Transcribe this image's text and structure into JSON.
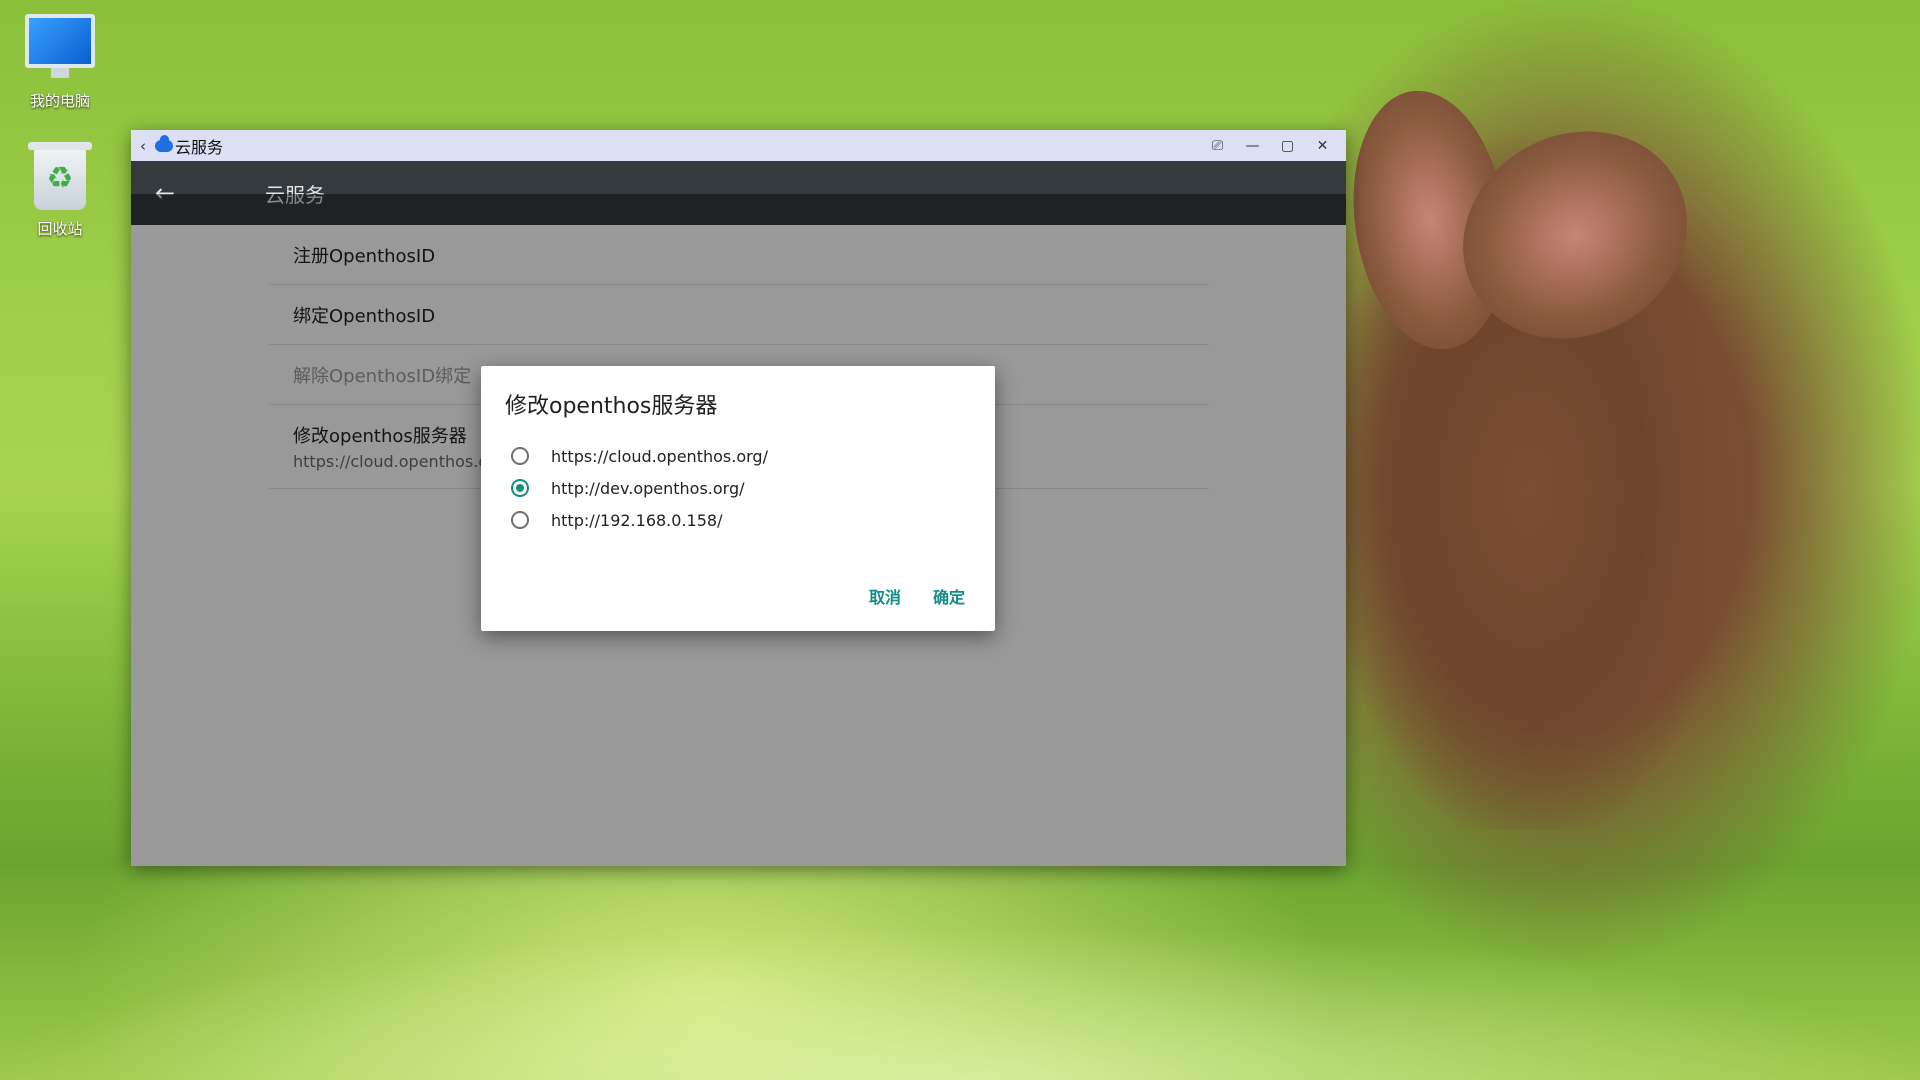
{
  "desktop": {
    "icons": [
      {
        "label": "我的电脑"
      },
      {
        "label": "回收站"
      }
    ]
  },
  "window": {
    "title": "云服务",
    "controls": {
      "lock": "⎚",
      "minimize": "—",
      "maximize": "▢",
      "close": "✕"
    }
  },
  "appbar": {
    "title": "云服务"
  },
  "settings": {
    "items": [
      {
        "title": "注册OpenthosID"
      },
      {
        "title": "绑定OpenthosID"
      },
      {
        "title": "解除OpenthosID绑定"
      },
      {
        "title": "修改openthos服务器",
        "summary": "https://cloud.openthos.org/"
      }
    ]
  },
  "dialog": {
    "title": "修改openthos服务器",
    "options": [
      {
        "label": "https://cloud.openthos.org/",
        "selected": false
      },
      {
        "label": "http://dev.openthos.org/",
        "selected": true
      },
      {
        "label": "http://192.168.0.158/",
        "selected": false
      }
    ],
    "cancel": "取消",
    "confirm": "确定"
  },
  "colors": {
    "accent": "#138d87",
    "appbar": "#343a3d",
    "titlebar": "#dde0f4"
  }
}
